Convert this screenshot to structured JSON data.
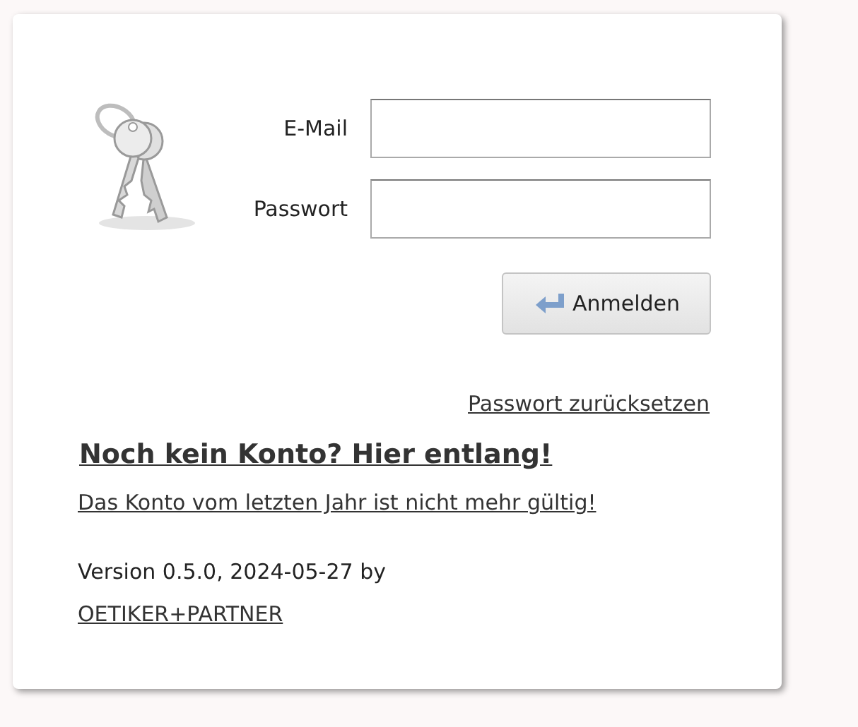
{
  "form": {
    "fields": [
      {
        "label": "E-Mail"
      },
      {
        "label": "Passwort"
      }
    ],
    "submit": "Anmelden",
    "reset_link": "Passwort zurücksetzen"
  },
  "signup": {
    "heading_link": "Noch kein Konto? Hier entlang!",
    "notice_link": "Das Konto vom letzten Jahr ist nicht mehr gültig!"
  },
  "footer": {
    "version": "Version 0.5.0, 2024-05-27 by",
    "company_link": "OETIKER+PARTNER"
  }
}
